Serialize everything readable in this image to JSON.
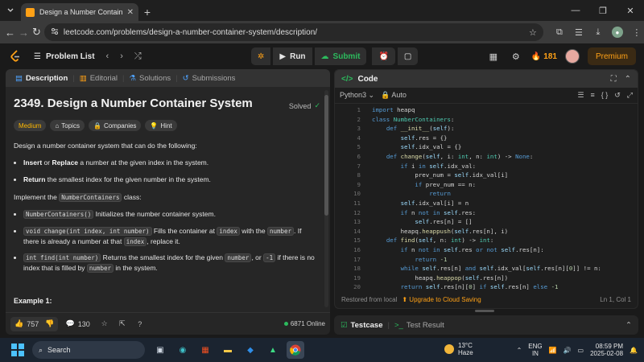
{
  "browser": {
    "tab_title": "Design a Number Container Sys",
    "url": "leetcode.com/problems/design-a-number-container-system/description/"
  },
  "lc_nav": {
    "problem_list_label": "Problem List",
    "run_label": "Run",
    "submit_label": "Submit",
    "streak_count": "181",
    "premium_label": "Premium"
  },
  "left_tabs": {
    "description": "Description",
    "editorial": "Editorial",
    "solutions": "Solutions",
    "submissions": "Submissions"
  },
  "problem": {
    "title": "2349. Design a Number Container System",
    "status": "Solved",
    "difficulty": "Medium",
    "topics_label": "Topics",
    "companies_label": "Companies",
    "hint_label": "Hint",
    "intro": "Design a number container system that can do the following:",
    "b1_bold": "Insert",
    "b1_or": " or ",
    "b1_bold2": "Replace",
    "b1_rest": " a number at the given index in the system.",
    "b2_bold": "Return",
    "b2_rest": " the smallest index for the given number in the system.",
    "impl_pre": "Implement the ",
    "impl_code": "NumberContainers",
    "impl_post": " class:",
    "m1_code": "NumberContainers()",
    "m1_text": " Initializes the number container system.",
    "m2_code": "void change(int index, int number)",
    "m2_t1": " Fills the container at ",
    "m2_c2": "index",
    "m2_t2": " with the ",
    "m2_c3": "number",
    "m2_t3": ". If there is already a number at that ",
    "m2_c4": "index",
    "m2_t4": ", replace it.",
    "m3_code": "int find(int number)",
    "m3_t1": " Returns the smallest index for the given ",
    "m3_c2": "number",
    "m3_t2": ", or ",
    "m3_c3": "-1",
    "m3_t3": " if there is no index that is filled by ",
    "m3_c4": "number",
    "m3_t4": " in the system.",
    "example_heading": "Example 1:"
  },
  "left_footer": {
    "likes": "757",
    "comments": "130",
    "online": "6871 Online"
  },
  "code_panel": {
    "title": "Code",
    "language": "Python3",
    "mode": "Auto",
    "restored": "Restored from local",
    "upgrade": "Upgrade to Cloud Saving",
    "position": "Ln 1, Col 1"
  },
  "code_lines": [
    "import heapq",
    "class NumberContainers:",
    "    def __init__(self):",
    "        self.res = {}",
    "        self.idx_val = {}",
    "    def change(self, i: int, n: int) -> None:",
    "        if i in self.idx_val:",
    "            prev_num = self.idx_val[i]",
    "            if prev_num == n:",
    "                return",
    "        self.idx_val[i] = n",
    "        if n not in self.res:",
    "            self.res[n] = []",
    "        heapq.heappush(self.res[n], i)",
    "    def find(self, n: int) -> int:",
    "        if n not in self.res or not self.res[n]:",
    "            return -1",
    "        while self.res[n] and self.idx_val[self.res[n][0]] != n:",
    "            heapq.heappop(self.res[n])",
    "        return self.res[n][0] if self.res[n] else -1"
  ],
  "testcase": {
    "testcase_label": "Testcase",
    "result_label": "Test Result"
  },
  "taskbar": {
    "search_placeholder": "Search",
    "weather_temp": "13°C",
    "weather_desc": "Haze",
    "lang_top": "ENG",
    "lang_bottom": "IN",
    "time": "08:59 PM",
    "date": "2025-02-08"
  }
}
